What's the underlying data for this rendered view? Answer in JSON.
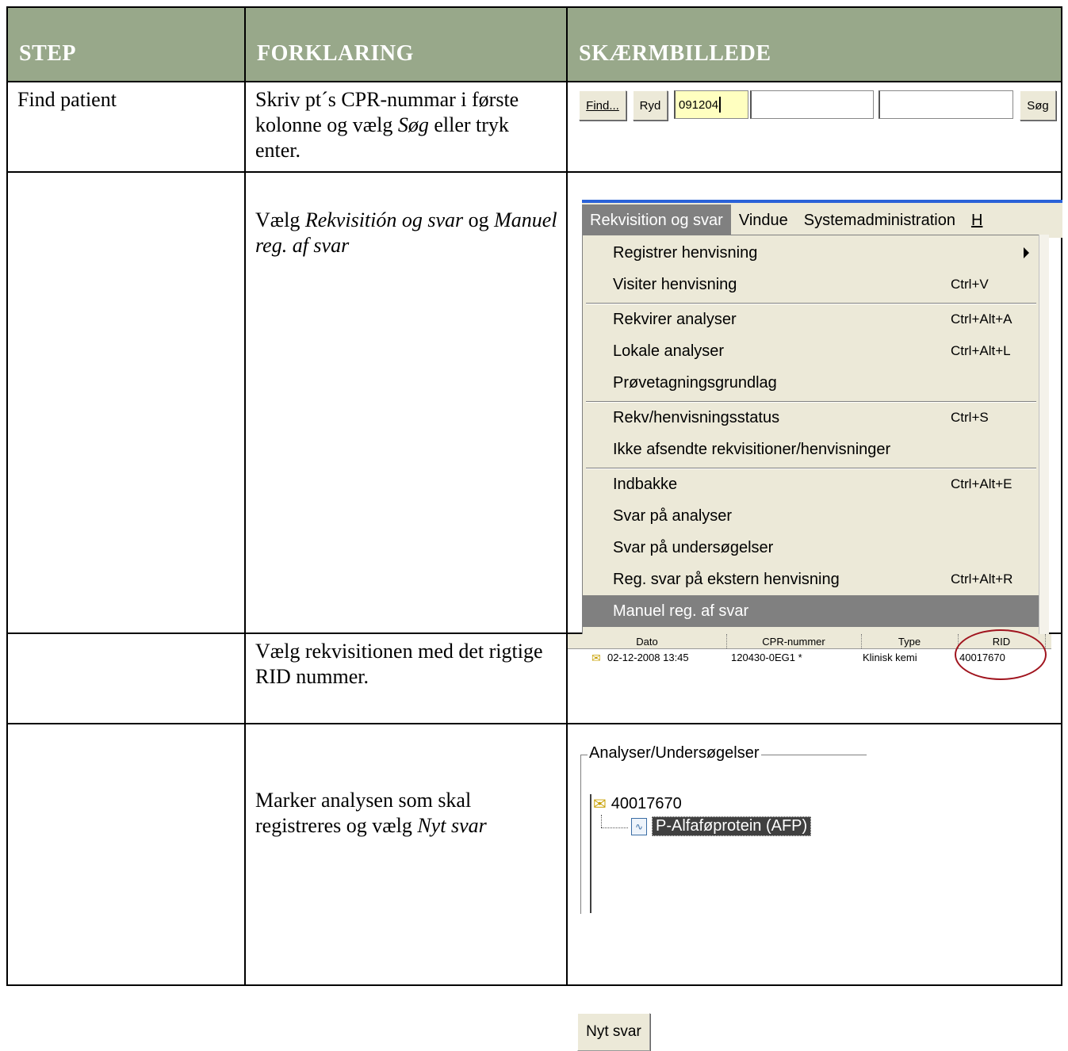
{
  "headers": {
    "step": "STEP",
    "forklaring": "FORKLARING",
    "skaermbillede": "SKÆRMBILLEDE"
  },
  "rows": [
    {
      "step": "Find patient",
      "explanation_parts": [
        "Skriv pt´s CPR-nummar i første kolonne og vælg ",
        "Søg",
        " eller tryk enter."
      ]
    },
    {
      "step": "",
      "explanation_parts": [
        "Vælg ",
        "Rekvisitión og svar",
        " og ",
        "Manuel reg. af svar",
        ""
      ]
    },
    {
      "step": "",
      "explanation_parts": [
        "Vælg rekvisitionen med det rigtige RID nummer."
      ]
    },
    {
      "step": "",
      "explanation_parts": [
        "Marker analysen som skal registreres og vælg ",
        "Nyt svar",
        ""
      ]
    }
  ],
  "search_bar": {
    "find_button": "Find...",
    "ryd_button": "Ryd",
    "cpr_value": "091204",
    "field2_value": "",
    "field3_value": "",
    "sog_button": "Søg"
  },
  "menu": {
    "bar_items": [
      "Rekvisition og svar",
      "Vindue",
      "Systemadministration",
      "H"
    ],
    "items": [
      {
        "label": "Registrer henvisning",
        "shortcut": "",
        "submenu": true
      },
      {
        "label": "Visiter henvisning",
        "shortcut": "Ctrl+V"
      },
      {
        "label": "Rekvirer analyser",
        "shortcut": "Ctrl+Alt+A"
      },
      {
        "label": "Lokale analyser",
        "shortcut": "Ctrl+Alt+L"
      },
      {
        "label": "Prøvetagningsgrundlag",
        "shortcut": ""
      },
      {
        "label": "Rekv/henvisningsstatus",
        "shortcut": "Ctrl+S"
      },
      {
        "label": "Ikke afsendte rekvisitioner/henvisninger",
        "shortcut": ""
      },
      {
        "label": "Indbakke",
        "shortcut": "Ctrl+Alt+E"
      },
      {
        "label": "Svar på analyser",
        "shortcut": ""
      },
      {
        "label": "Svar på undersøgelser",
        "shortcut": ""
      },
      {
        "label": "Reg. svar på ekstern henvisning",
        "shortcut": "Ctrl+Alt+R"
      },
      {
        "label": "Manuel reg. af svar",
        "shortcut": "",
        "highlighted": true
      }
    ]
  },
  "grid": {
    "columns": [
      "Dato",
      "CPR-nummer",
      "Type",
      "RID"
    ],
    "row": [
      "02-12-2008 13:45",
      "120430-0EG1 *",
      "Klinisk kemi",
      "40017670"
    ]
  },
  "tree": {
    "group_label": "Analyser/Undersøgelser",
    "root": "40017670",
    "child": "P-Alfaføprotein (AFP)",
    "button": "Nyt svar"
  },
  "colors": {
    "header_bg": "#98a88a",
    "menu_bg": "#ece9d8",
    "highlight": "#808080",
    "cpr_field": "#ffffc0",
    "ellipse": "#a0141e"
  }
}
